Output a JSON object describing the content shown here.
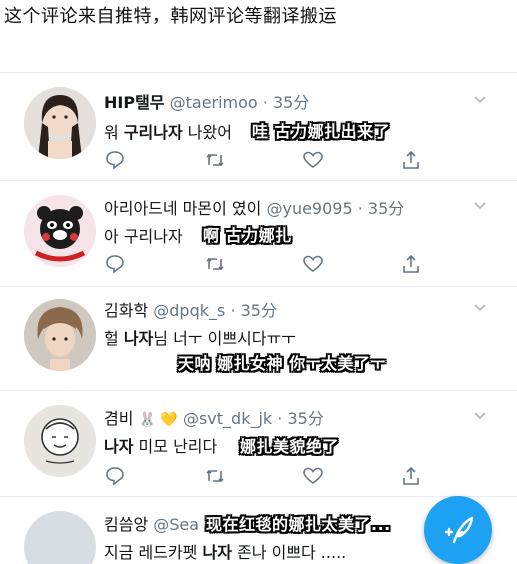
{
  "header": {
    "caption": "这个评论来自推特，韩网评论等翻译搬运"
  },
  "tweets": [
    {
      "name": "HIP탤무",
      "handle": "@taerimoo",
      "time": "· 35分",
      "text_pre": "워 ",
      "text_hl": "구리나자",
      "text_post": " 나왔어",
      "caption": "哇 古力娜扎出来了"
    },
    {
      "name": "아리아드네 마몬이 였이",
      "handle": "@yue9095",
      "time": "· 35分",
      "text_pre": "아 ",
      "text_hl": "구리나자",
      "text_post": "",
      "caption": "啊 古力娜扎"
    },
    {
      "name": "김화학",
      "handle": "@dpqk_s",
      "time": "· 35分",
      "text_pre": "헐 ",
      "text_hl": "나자",
      "text_post": "님 너ㅜ 이쁘시다ㅠㅜ",
      "caption": "天呐 娜扎女神 你ㅜ太美了ㅜ"
    },
    {
      "name": "겸비",
      "handle": "@svt_dk_jk",
      "time": "· 35分",
      "emoji": "🐰 💛",
      "text_pre": "",
      "text_hl": "나자",
      "text_post": " 미모 난리다",
      "caption": "娜扎美貌绝了"
    },
    {
      "name": "킴씀앙",
      "handle": "@Sea",
      "text_pre": "지금 레드카펫 ",
      "text_hl": "나자",
      "text_post": " 존나 이쁘다 .....",
      "caption": "现在红毯的娜扎太美了..."
    }
  ],
  "colors": {
    "accent": "#1da1f2",
    "icon": "#657786",
    "divider": "#e6ecf0"
  },
  "icons": [
    "reply-icon",
    "retweet-icon",
    "like-icon",
    "share-icon",
    "chevron-down-icon",
    "compose-icon"
  ]
}
